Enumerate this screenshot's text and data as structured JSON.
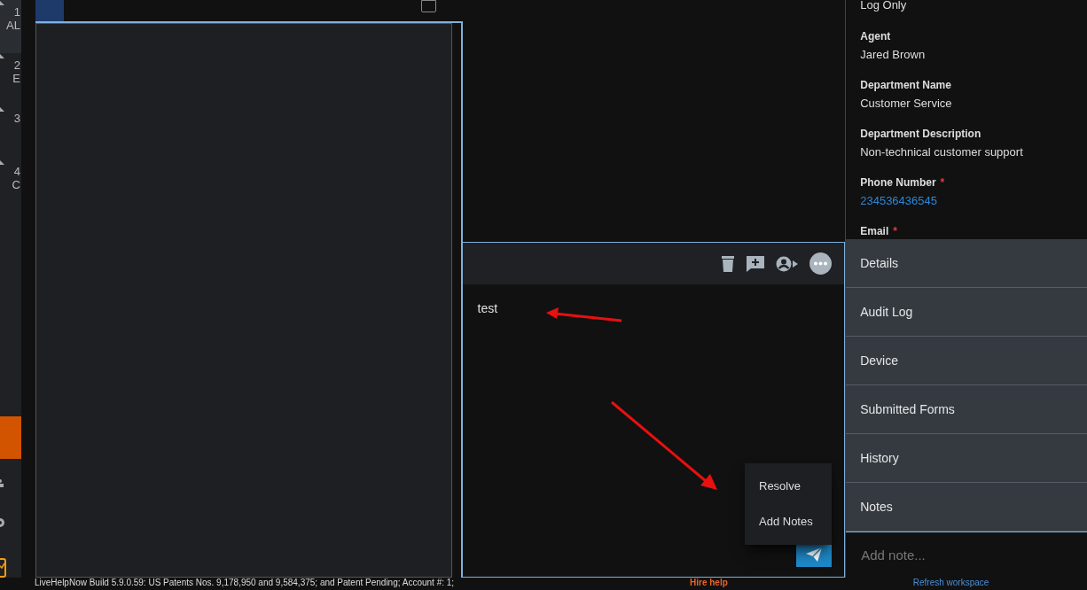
{
  "sidebar": {
    "items": [
      {
        "number": "1",
        "label": "AL",
        "selected": true
      },
      {
        "number": "2",
        "label": "E",
        "selected": false
      },
      {
        "number": "3",
        "selected": false
      },
      {
        "number": "4",
        "label": "C",
        "selected": false
      }
    ]
  },
  "checkbox": {
    "checked": false
  },
  "chat": {
    "message": "test",
    "toolbar": [
      {
        "kind": "delete"
      },
      {
        "kind": "add-comment"
      },
      {
        "kind": "transfer"
      },
      {
        "kind": "more"
      }
    ],
    "menu": [
      {
        "label": "Resolve"
      },
      {
        "label": "Add Notes"
      }
    ]
  },
  "details": {
    "first_value": "Log Only",
    "fields": [
      {
        "label": "Agent",
        "value": "Jared Brown",
        "required": false,
        "link": false
      },
      {
        "label": "Department Name",
        "value": "Customer Service",
        "required": false,
        "link": false
      },
      {
        "label": "Department Description",
        "value": "Non-technical customer support",
        "required": false,
        "link": false
      },
      {
        "label": "Phone Number",
        "value": "234536436545",
        "required": true,
        "link": true
      },
      {
        "label": "Email",
        "required": true,
        "link": false
      }
    ],
    "required_mark": "*",
    "sections": [
      "Details",
      "Audit Log",
      "Device",
      "Submitted Forms",
      "History",
      "Notes"
    ],
    "note_placeholder": "Add note..."
  },
  "footer": {
    "build": "LiveHelpNow Build 5.9.0.59: US Patents Nos. 9,178,950 and 9,584,375; and Patent Pending; Account #: 1;",
    "hire": "Hire help",
    "refresh": "Refresh workspace"
  }
}
